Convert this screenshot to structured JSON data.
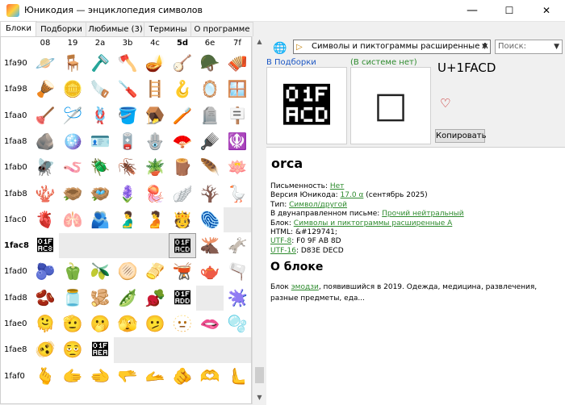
{
  "window": {
    "title": "Юникодия — энциклопедия символов",
    "min": "—",
    "max": "☐",
    "close": "✕"
  },
  "tabs": [
    "Блоки",
    "Подборки",
    "Любимые (3)",
    "Термины",
    "О программе"
  ],
  "grid": {
    "columns": [
      "08",
      "19",
      "2a",
      "3b",
      "4c",
      "5d",
      "6e",
      "7f"
    ],
    "rows": [
      {
        "label": "1fa90",
        "cells": [
          "🪐",
          "🪑",
          "🪒",
          "🪓",
          "🪔",
          "🪕",
          "🪖",
          "🪗"
        ]
      },
      {
        "label": "1fa98",
        "cells": [
          "🪘",
          "🪙",
          "🪚",
          "🪛",
          "🪜",
          "🪝",
          "🪞",
          "🪟"
        ]
      },
      {
        "label": "1faa0",
        "cells": [
          "🪠",
          "🪡",
          "🪢",
          "🪣",
          "🪤",
          "🪥",
          "🪦",
          "🪧"
        ]
      },
      {
        "label": "1faa8",
        "cells": [
          "🪨",
          "🪩",
          "🪪",
          "🪫",
          "🪬",
          "🪭",
          "🪮",
          "🪯"
        ]
      },
      {
        "label": "1fab0",
        "cells": [
          "🪰",
          "🪱",
          "🪲",
          "🪳",
          "🪴",
          "🪵",
          "🪶",
          "🪷"
        ]
      },
      {
        "label": "1fab8",
        "cells": [
          "🪸",
          "🪹",
          "🪺",
          "🪻",
          "🪼",
          "🪽",
          "🪾",
          "🪿"
        ]
      },
      {
        "label": "1fac0",
        "cells": [
          "🫀",
          "🫁",
          "🫂",
          "🫃",
          "🫄",
          "🫅",
          "🫆",
          ""
        ]
      },
      {
        "label": "1fac8",
        "cells": [
          "🫈",
          "",
          "",
          "",
          "",
          "🫍",
          "🫎",
          "🫏"
        ]
      },
      {
        "label": "1fad0",
        "cells": [
          "🫐",
          "🫑",
          "🫒",
          "🫓",
          "🫔",
          "🫕",
          "🫖",
          "🫗"
        ]
      },
      {
        "label": "1fad8",
        "cells": [
          "🫘",
          "🫙",
          "🫚",
          "🫛",
          "🫜",
          "🫝",
          "",
          "🫟"
        ]
      },
      {
        "label": "1fae0",
        "cells": [
          "🫠",
          "🫡",
          "🫢",
          "🫣",
          "🫤",
          "🫥",
          "🫦",
          "🫧"
        ]
      },
      {
        "label": "1fae8",
        "cells": [
          "🫨",
          "🫩",
          "🫪",
          "",
          "",
          "",
          "",
          ""
        ]
      },
      {
        "label": "1faf0",
        "cells": [
          "🫰",
          "🫱",
          "🫲",
          "🫳",
          "🫴",
          "🫵",
          "🫶",
          "🫷"
        ]
      }
    ],
    "selected_row": 7,
    "selected_col": 5,
    "bold_col": 5
  },
  "toolbar": {
    "icon": "globe-font-icon",
    "block_value": "Символы и пиктограммы расширенные А",
    "search_placeholder": "Поиск:"
  },
  "preview": {
    "collection_link": "В Подборки",
    "system_label": "(В системе нет)",
    "glyph": "🫍",
    "fallback": "□",
    "code": "U+1FACD",
    "favorite": "♡",
    "copy": "Копировать"
  },
  "info": {
    "name": "orca",
    "props": [
      {
        "k": "Письменность:",
        "v": "Нет",
        "s": ""
      },
      {
        "k": "Версия Юникода:",
        "v": "17.0 α",
        "s": " (сентябрь 2025)"
      },
      {
        "k": "Тип:",
        "v": "Символ/другой",
        "s": ""
      },
      {
        "k": "В двунаправленном письме:",
        "v": "Прочий нейтральный",
        "s": ""
      },
      {
        "k": "Блок:",
        "v": "Символы и пиктограммы расширенные А",
        "s": ""
      },
      {
        "k": "HTML:",
        "v": "",
        "s": "&#129741;"
      },
      {
        "k": "UTF-8",
        "v": "",
        "s": ": F0 9F AB 8D"
      },
      {
        "k": "UTF-16",
        "v": "",
        "s": ": D83E DECD"
      }
    ],
    "about_title": "О блоке",
    "about_pre": "Блок ",
    "about_link": "эмодзи",
    "about_post": ", появившийся в 2019. Одежда, медицина, развлечения, разные предметы, еда..."
  }
}
